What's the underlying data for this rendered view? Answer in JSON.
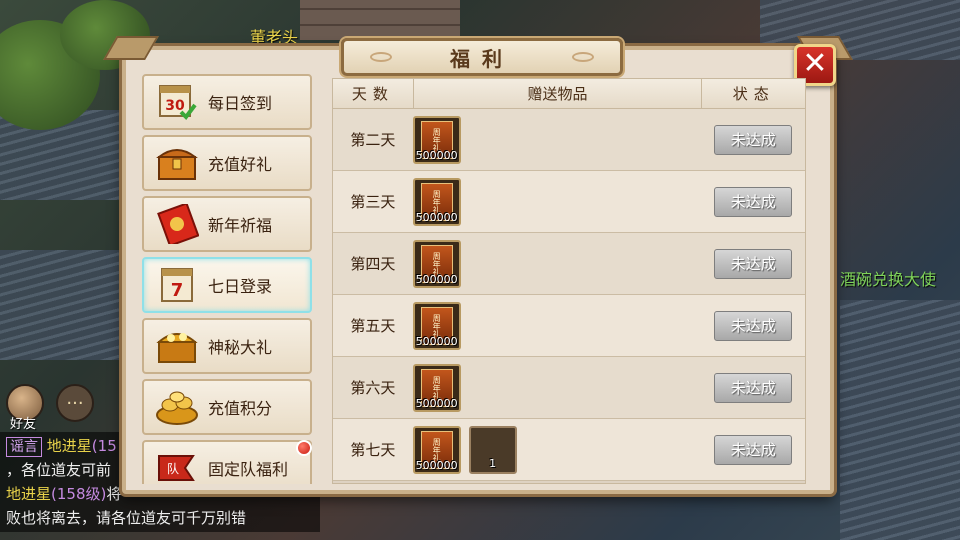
{
  "scene": {
    "npc_names": [
      "董老头",
      "酒碗兑换大使"
    ],
    "friend_label": "好友"
  },
  "chat": {
    "line1_tag": "谣言",
    "line1_name": "地进星",
    "line1_level": "(15",
    "line2": "，各位道友可前",
    "line3_name": "地进星",
    "line3_level": "(158级)",
    "line3_rest": "将",
    "line4": "败也将离去，请各位道友可千万别错"
  },
  "panel": {
    "title": "福利",
    "close_label": "✕"
  },
  "sidebar": {
    "items": [
      {
        "label": "每日签到",
        "icon": "calendar-30-icon",
        "active": false
      },
      {
        "label": "充值好礼",
        "icon": "treasure-chest-icon",
        "active": false
      },
      {
        "label": "新年祈福",
        "icon": "red-envelope-icon",
        "active": false
      },
      {
        "label": "七日登录",
        "icon": "calendar-7-icon",
        "active": true
      },
      {
        "label": "神秘大礼",
        "icon": "gold-chest-icon",
        "active": false
      },
      {
        "label": "充值积分",
        "icon": "gold-coins-icon",
        "active": false
      },
      {
        "label": "固定队福利",
        "icon": "team-flag-icon",
        "active": false,
        "badge": true
      }
    ]
  },
  "table": {
    "headers": [
      "天数",
      "赠送物品",
      "状态"
    ],
    "rows": [
      {
        "day": "第二天",
        "items": [
          {
            "qty": "500000",
            "card": "周年礼"
          }
        ],
        "status": "未达成"
      },
      {
        "day": "第三天",
        "items": [
          {
            "qty": "500000",
            "card": "周年礼"
          }
        ],
        "status": "未达成"
      },
      {
        "day": "第四天",
        "items": [
          {
            "qty": "500000",
            "card": "周年礼"
          }
        ],
        "status": "未达成"
      },
      {
        "day": "第五天",
        "items": [
          {
            "qty": "500000",
            "card": "周年礼"
          }
        ],
        "status": "未达成"
      },
      {
        "day": "第六天",
        "items": [
          {
            "qty": "500000",
            "card": "周年礼"
          }
        ],
        "status": "未达成"
      },
      {
        "day": "第七天",
        "items": [
          {
            "qty": "500000",
            "card": "周年礼"
          },
          {
            "qty": "1",
            "card": ""
          }
        ],
        "status": "未达成"
      }
    ]
  }
}
